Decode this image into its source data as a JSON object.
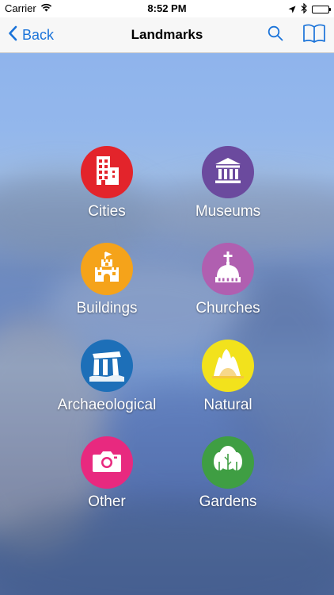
{
  "status_bar": {
    "carrier": "Carrier",
    "time": "8:52 PM"
  },
  "nav": {
    "back_label": "Back",
    "title": "Landmarks",
    "accent_color": "#1a73d9"
  },
  "categories": [
    {
      "label": "Cities",
      "icon": "city-buildings-icon",
      "color": "#e3242b"
    },
    {
      "label": "Museums",
      "icon": "museum-icon",
      "color": "#6b4a9e"
    },
    {
      "label": "Buildings",
      "icon": "castle-icon",
      "color": "#f5a31a"
    },
    {
      "label": "Churches",
      "icon": "church-dome-icon",
      "color": "#b05fb0"
    },
    {
      "label": "Archaeological",
      "icon": "ruins-icon",
      "color": "#1d6fb8"
    },
    {
      "label": "Natural",
      "icon": "mountain-sun-icon",
      "color": "#f2e21c"
    },
    {
      "label": "Other",
      "icon": "camera-icon",
      "color": "#e8297f"
    },
    {
      "label": "Gardens",
      "icon": "tree-icon",
      "color": "#3f9e43"
    }
  ]
}
